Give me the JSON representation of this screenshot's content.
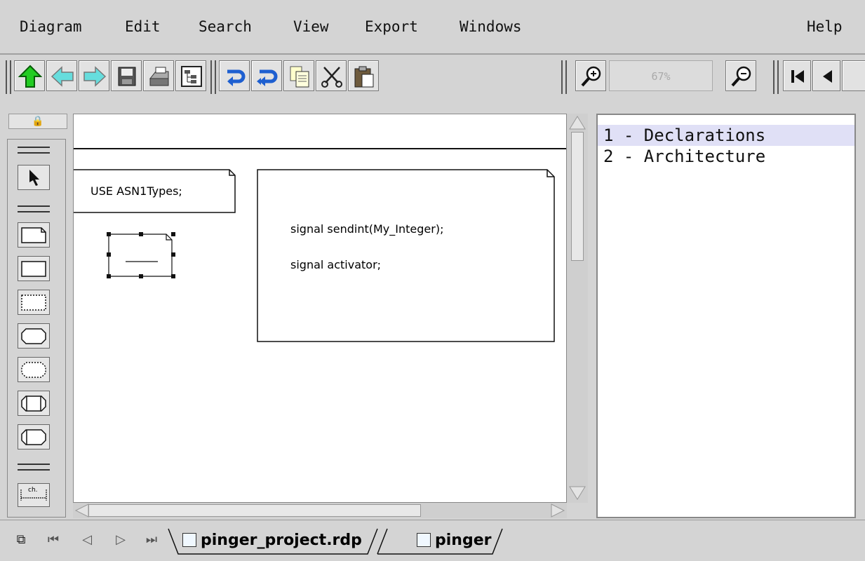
{
  "menubar": {
    "items": [
      "Diagram",
      "Edit",
      "Search",
      "View",
      "Export",
      "Windows"
    ],
    "help": "Help"
  },
  "toolbar": {
    "zoom": "67%",
    "icons": [
      "go-up-icon",
      "back-arrow-icon",
      "forward-arrow-icon",
      "save-icon",
      "print-icon",
      "diagram-tree-icon",
      "undo-icon",
      "redo-icon",
      "copy-icon",
      "cut-icon",
      "paste-icon",
      "zoom-in-icon",
      "zoom-out-icon",
      "first-page-icon",
      "previous-page-icon"
    ]
  },
  "palette": {
    "lock_icon": "🔒",
    "tools": [
      "select-tool",
      "text-note-tool",
      "block-tool",
      "dashed-block-tool",
      "process-tool",
      "dashed-process-tool",
      "procedure-tool",
      "service-tool",
      "channel-tool"
    ],
    "channel_label": "ch."
  },
  "canvas": {
    "use_note": "USE ASN1Types;",
    "signal_lines": [
      "signal sendint(My_Integer);",
      "signal activator;"
    ]
  },
  "outline": {
    "items": [
      "1 - Declarations",
      "2 - Architecture"
    ]
  },
  "bottom": {
    "tabs": [
      "pinger_project.rdp",
      "pinger"
    ]
  },
  "colors": {
    "selected_row": "#e0e0f6",
    "arrow_green": "#22cc22",
    "arrow_cyan": "#66dddd",
    "undo_blue": "#1e5fd0"
  }
}
